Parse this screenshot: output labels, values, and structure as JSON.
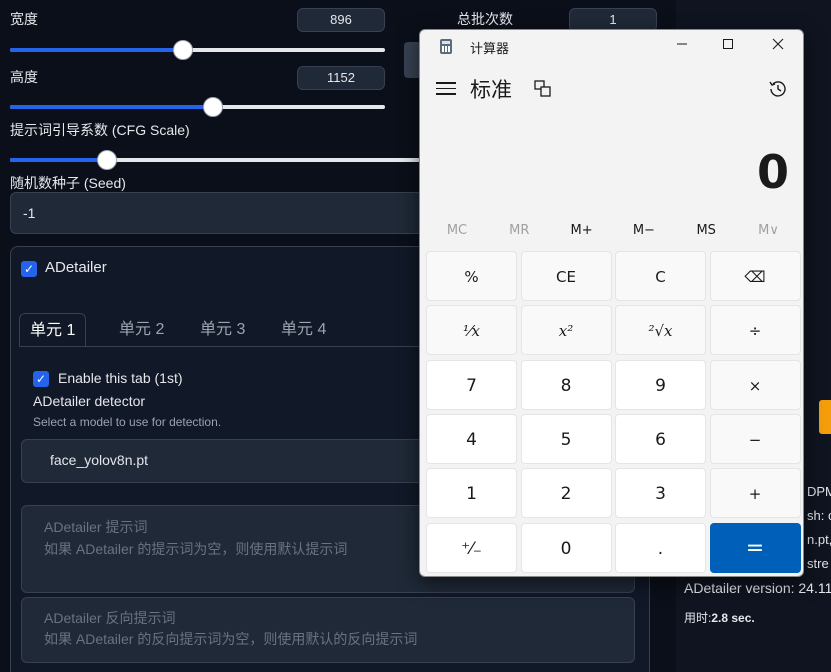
{
  "webui": {
    "width_label": "宽度",
    "width_value": "896",
    "width_slider": 0.46,
    "batch_count_label": "总批次数",
    "batch_count_value": "1",
    "height_label": "高度",
    "height_value": "1152",
    "height_slider": 0.54,
    "cfg_label": "提示词引导系数 (CFG Scale)",
    "cfg_slider": 0.23,
    "seed_label": "随机数种子 (Seed)",
    "seed_value": "-1",
    "adetailer": {
      "title": "ADetailer",
      "tabs": [
        "单元 1",
        "单元 2",
        "单元 3",
        "单元 4"
      ],
      "enable_label": "Enable this tab (1st)",
      "detector_label": "ADetailer detector",
      "detector_hint": "Select a model to use for detection.",
      "detector_value": "face_yolov8n.pt",
      "prompt_label": "ADetailer 提示词",
      "prompt_placeholder": "如果 ADetailer 的提示词为空，则使用默认提示词",
      "neg_prompt_label": "ADetailer 反向提示词",
      "neg_prompt_placeholder": "如果 ADetailer 的反向提示词为空，则使用默认的反向提示词"
    },
    "right_panel": {
      "line1": "DPM",
      "line2": "sh: c",
      "line3": "n.pt,",
      "line4": "stre",
      "version": "ADetailer version: 24.11.",
      "time_label": "用时:",
      "time_value": "2.8 sec."
    }
  },
  "calculator": {
    "window_title": "计算器",
    "mode": "标准",
    "display": "0",
    "memory": [
      {
        "label": "MC",
        "enabled": false
      },
      {
        "label": "MR",
        "enabled": false
      },
      {
        "label": "M+",
        "enabled": true
      },
      {
        "label": "M−",
        "enabled": true
      },
      {
        "label": "MS",
        "enabled": true
      },
      {
        "label": "M∨",
        "enabled": false
      }
    ],
    "keys": [
      [
        "%",
        "CE",
        "C",
        "⌫"
      ],
      [
        "¹⁄x",
        "x²",
        "²√x",
        "÷"
      ],
      [
        "7",
        "8",
        "9",
        "×"
      ],
      [
        "4",
        "5",
        "6",
        "−"
      ],
      [
        "1",
        "2",
        "3",
        "+"
      ],
      [
        "⁺⁄₋",
        "0",
        ".",
        "="
      ]
    ]
  },
  "colors": {
    "accent": "#2563eb",
    "calc_equals": "#005fb8",
    "page_bg": "#0b0f19"
  }
}
